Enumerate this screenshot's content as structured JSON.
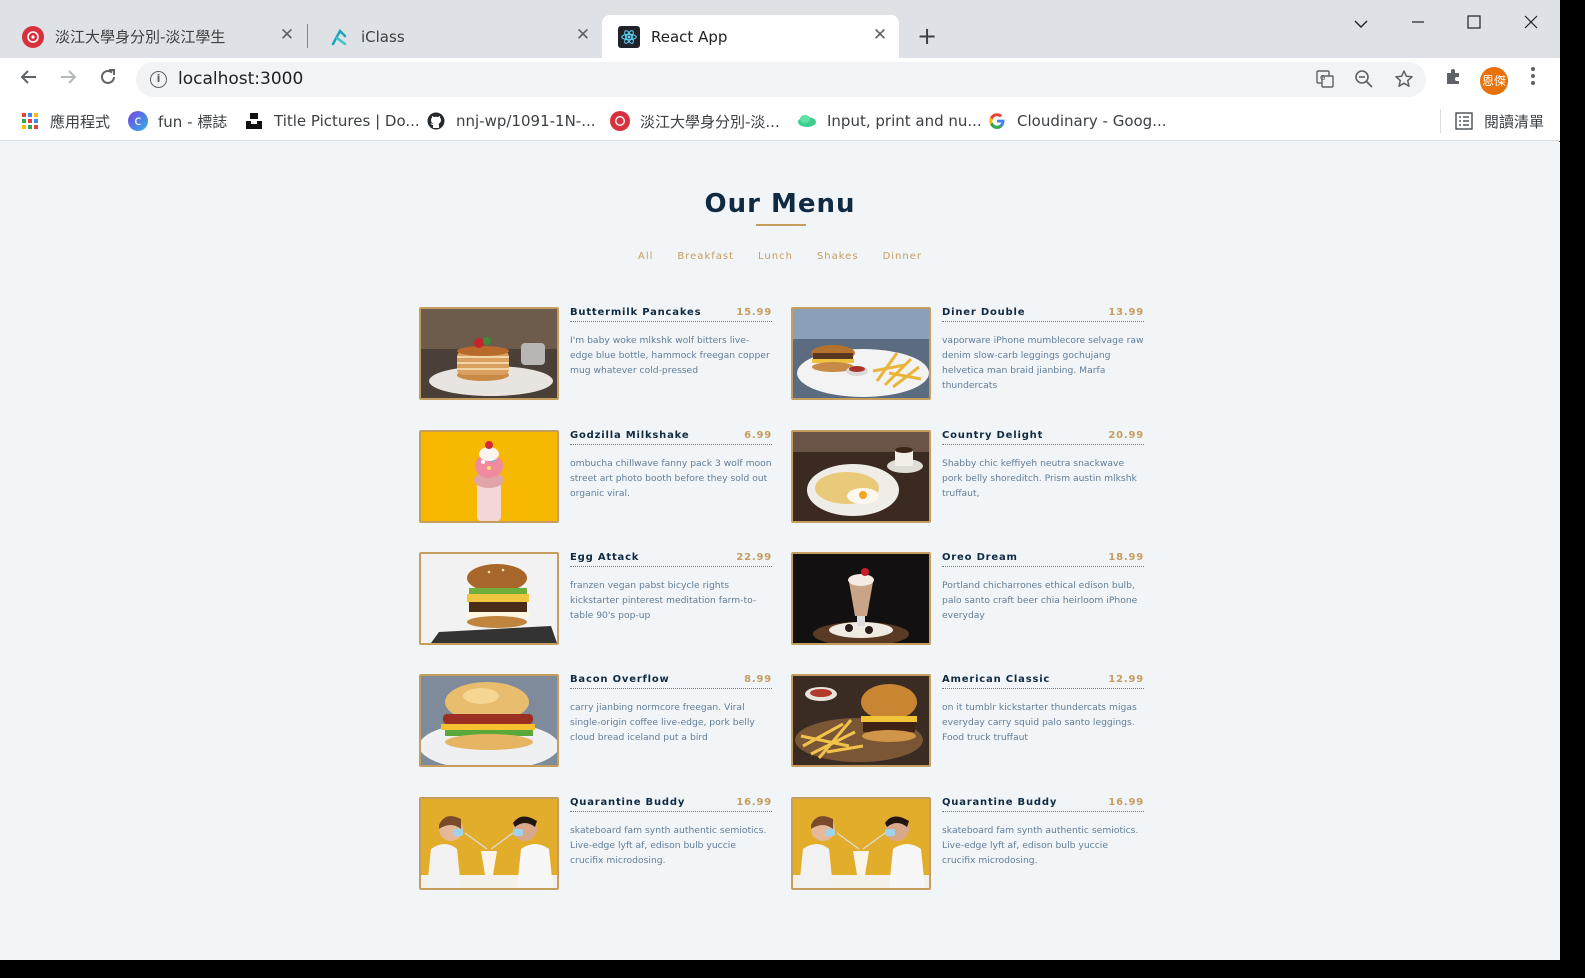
{
  "browser": {
    "tabs": [
      {
        "title": "淡江大學身分別-淡江學生",
        "active": false
      },
      {
        "title": "iClass",
        "active": false
      },
      {
        "title": "React App",
        "active": true
      }
    ],
    "new_tab": "+",
    "address": "localhost:3000",
    "profile_initials": "恩傑",
    "bookmarks": [
      {
        "label": "應用程式",
        "icon": "apps-grid-icon"
      },
      {
        "label": "fun - 標誌",
        "icon": "canva-icon"
      },
      {
        "label": "Title Pictures | Do...",
        "icon": "unsplash-icon"
      },
      {
        "label": "nnj-wp/1091-1N-...",
        "icon": "github-icon"
      },
      {
        "label": "淡江大學身分別-淡...",
        "icon": "tku-icon"
      },
      {
        "label": "Input, print and nu...",
        "icon": "cloud-icon"
      },
      {
        "label": "Cloudinary - Goog...",
        "icon": "google-icon"
      }
    ],
    "reading_list": "閱讀清單"
  },
  "menu": {
    "title": "Our Menu",
    "filters": [
      "All",
      "Breakfast",
      "Lunch",
      "Shakes",
      "Dinner"
    ],
    "items": [
      {
        "name": "Buttermilk Pancakes",
        "price": "15.99",
        "desc": "I'm baby woke mlkshk wolf bitters live-edge blue bottle, hammock freegan copper mug whatever cold-pressed",
        "photo": "pancakes"
      },
      {
        "name": "Diner Double",
        "price": "13.99",
        "desc": "vaporware iPhone mumblecore selvage raw denim slow-carb leggings gochujang helvetica man braid jianbing. Marfa thundercats",
        "photo": "burger-fries"
      },
      {
        "name": "Godzilla Milkshake",
        "price": "6.99",
        "desc": "ombucha chillwave fanny pack 3 wolf moon street art photo booth before they sold out organic viral.",
        "photo": "milkshake"
      },
      {
        "name": "Country Delight",
        "price": "20.99",
        "desc": "Shabby chic keffiyeh neutra snackwave pork belly shoreditch. Prism austin mlkshk truffaut,",
        "photo": "eggs-plate"
      },
      {
        "name": "Egg Attack",
        "price": "22.99",
        "desc": "franzen vegan pabst bicycle rights kickstarter pinterest meditation farm-to-table 90's pop-up",
        "photo": "egg-burger"
      },
      {
        "name": "Oreo Dream",
        "price": "18.99",
        "desc": "Portland chicharrones ethical edison bulb, palo santo craft beer chia heirloom iPhone everyday",
        "photo": "oreo-shake"
      },
      {
        "name": "Bacon Overflow",
        "price": "8.99",
        "desc": "carry jianbing normcore freegan. Viral single-origin coffee live-edge, pork belly cloud bread iceland put a bird",
        "photo": "bacon-sandwich"
      },
      {
        "name": "American Classic",
        "price": "12.99",
        "desc": "on it tumblr kickstarter thundercats migas everyday carry squid palo santo leggings. Food truck truffaut",
        "photo": "classic-burger"
      },
      {
        "name": "Quarantine Buddy",
        "price": "16.99",
        "desc": "skateboard fam synth authentic semiotics. Live-edge lyft af, edison bulb yuccie crucifix microdosing.",
        "photo": "couple-shake"
      },
      {
        "name": "Quarantine Buddy",
        "price": "16.99",
        "desc": "skateboard fam synth authentic semiotics. Live-edge lyft af, edison bulb yuccie crucifix microdosing.",
        "photo": "couple-shake"
      }
    ]
  }
}
